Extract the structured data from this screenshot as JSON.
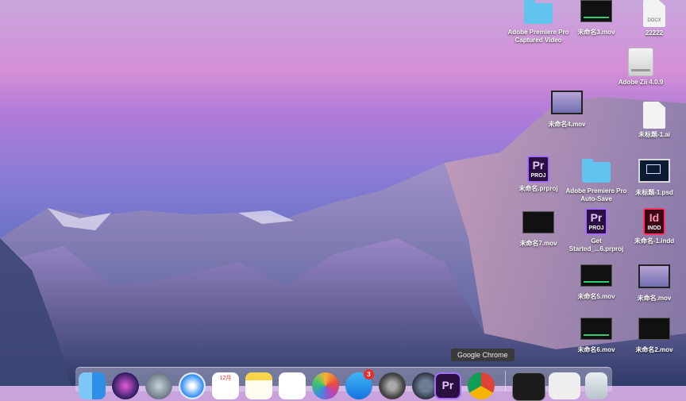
{
  "desktop": {
    "icons": [
      {
        "label": "Adobe Premiere Pro Captured Video",
        "kind": "folder-icon"
      },
      {
        "label": "未命名3.mov",
        "kind": "video-thumbnail-icon"
      },
      {
        "label": "22222",
        "kind": "docx-document-icon",
        "badge": "DOCX"
      },
      {
        "label": "Adobe Zii 4.0.9",
        "kind": "disk-image-icon"
      },
      {
        "label": "未命名4.mov",
        "kind": "video-thumbnail-icon"
      },
      {
        "label": "未标题-1.ai",
        "kind": "document-icon"
      },
      {
        "label": "未命名.prproj",
        "kind": "premiere-project-icon",
        "logo": "Pr",
        "sub": "PROJ"
      },
      {
        "label": "Adobe Premiere Pro Auto-Save",
        "kind": "folder-icon"
      },
      {
        "label": "未标题-1.psd",
        "kind": "photoshop-file-icon"
      },
      {
        "label": "未命名7.mov",
        "kind": "video-thumbnail-icon"
      },
      {
        "label": "Get Started_...6.prproj",
        "kind": "premiere-project-icon",
        "logo": "Pr",
        "sub": "PROJ"
      },
      {
        "label": "未命名-1.indd",
        "kind": "indesign-file-icon",
        "logo": "Id",
        "sub": "INDD"
      },
      {
        "label": "未命名5.mov",
        "kind": "video-thumbnail-icon"
      },
      {
        "label": "未命名.mov",
        "kind": "video-thumbnail-icon"
      },
      {
        "label": "未命名6.mov",
        "kind": "video-thumbnail-icon"
      },
      {
        "label": "未命名2.mov",
        "kind": "video-thumbnail-icon"
      }
    ]
  },
  "dock": {
    "tooltip": "Google Chrome",
    "app_store_badge": "3",
    "calendar_month": "12月",
    "items": [
      "finder-icon",
      "siri-icon",
      "launchpad-icon",
      "safari-icon",
      "calendar-icon",
      "notes-icon",
      "reminders-icon",
      "photos-icon",
      "app-store-icon",
      "system-preferences-icon",
      "quicktime-icon",
      "premiere-pro-icon",
      "google-chrome-icon",
      "downloads-stack-icon",
      "documents-stack-icon",
      "trash-icon"
    ]
  }
}
